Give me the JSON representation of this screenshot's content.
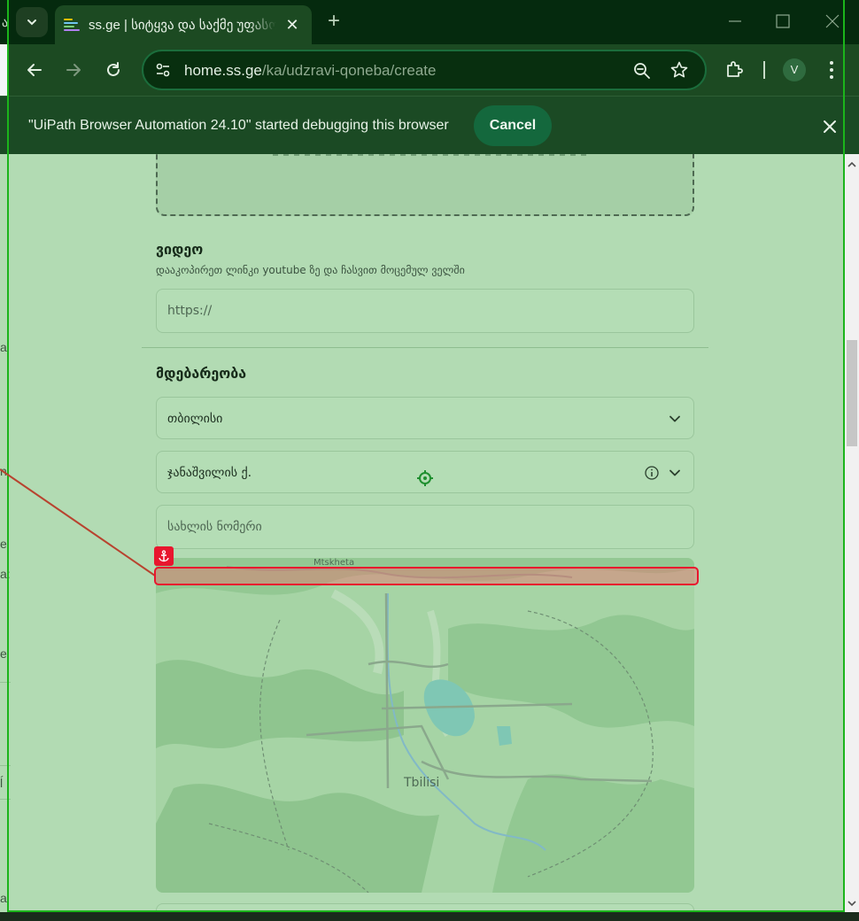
{
  "browser": {
    "tab": {
      "title": "ss.ge | სიტყვა და საქმე უფასოა"
    },
    "url": {
      "host": "home.ss.ge",
      "path": "/ka/udzravi-qoneba/create"
    },
    "profile_initial": "V",
    "left_sliver_text": "ა"
  },
  "infobar": {
    "message": "\"UiPath Browser Automation 24.10\" started debugging this browser",
    "cancel_label": "Cancel"
  },
  "page": {
    "video": {
      "title": "ვიდეო",
      "hint": "დააკოპირეთ ლინკი youtube ზე და ჩასვით მოცემულ ველში",
      "placeholder": "https://"
    },
    "location": {
      "title": "მდებარეობა",
      "city_value": "თბილისი",
      "street_value": "ჯანაშვილის ქ.",
      "house_placeholder": "სახლის ნომერი"
    },
    "map": {
      "labels": {
        "north_town": "Mtskheta",
        "city": "Tbilisi"
      }
    },
    "left_peek": [
      "ai",
      "n",
      "e",
      "a:",
      "e",
      "ĺ",
      "al"
    ]
  },
  "colors": {
    "overlay_green": "#b2dbb3",
    "highlight_red": "#e8162e",
    "frame_green": "#1bb51b",
    "chrome_dark": "#052a0e"
  }
}
